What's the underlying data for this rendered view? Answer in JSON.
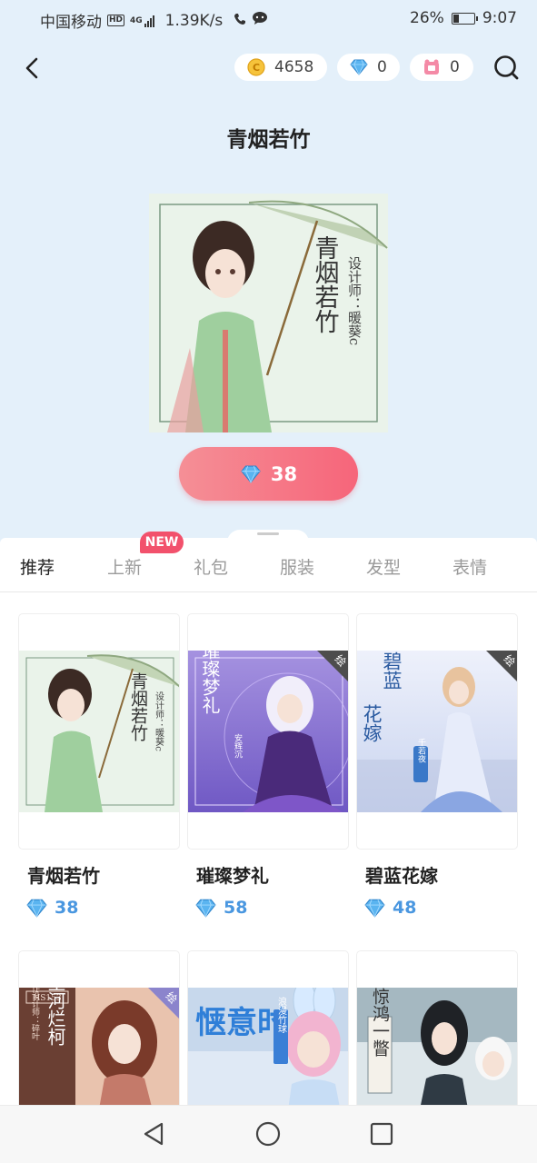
{
  "status": {
    "carrier": "中国移动",
    "hd": "HD",
    "net_type": "4G",
    "speed": "1.39K/s",
    "battery_pct": "26%",
    "battery_level": 0.26,
    "time": "9:07"
  },
  "header": {
    "coins": "4658",
    "diamonds": "0",
    "tickets": "0",
    "back_icon": "back-arrow-icon",
    "search_icon": "search-icon"
  },
  "product": {
    "title": "青烟若竹",
    "art_title": "青烟若竹",
    "art_designer": "设计师：暖葵c",
    "price": "38"
  },
  "tabs": [
    {
      "label": "推荐",
      "active": true
    },
    {
      "label": "上新",
      "active": false
    },
    {
      "label": "礼包",
      "active": false
    },
    {
      "label": "服装",
      "active": false
    },
    {
      "label": "发型",
      "active": false
    },
    {
      "label": "表情",
      "active": false
    }
  ],
  "new_badge": "NEW",
  "items": [
    {
      "name": "青烟若竹",
      "price": "38",
      "art_title": "青烟若竹",
      "art_sub": "设计师：暖葵c"
    },
    {
      "name": "璀璨梦礼",
      "price": "58",
      "art_title": "璀璨梦礼",
      "art_sub": "安辉沉"
    },
    {
      "name": "碧蓝花嫁",
      "price": "48",
      "art_title": "碧蓝花嫁",
      "art_sub": "千若夜"
    },
    {
      "name": "",
      "price": "",
      "art_title": "星河烂柯",
      "art_sub": "HS153",
      "art_extra": "合作设计师：碎叶"
    },
    {
      "name": "",
      "price": "",
      "art_title": "惬意时",
      "art_sub": "浪漫竹球"
    },
    {
      "name": "",
      "price": "",
      "art_title": "惊鸿一瞥",
      "art_sub": ""
    }
  ],
  "corner_badge": "绘",
  "colors": {
    "header_bg": "#e4f0fa",
    "buy_button": "#f6657a",
    "diamond_blue": "#4a97e0",
    "badge_red": "#f2516c"
  }
}
